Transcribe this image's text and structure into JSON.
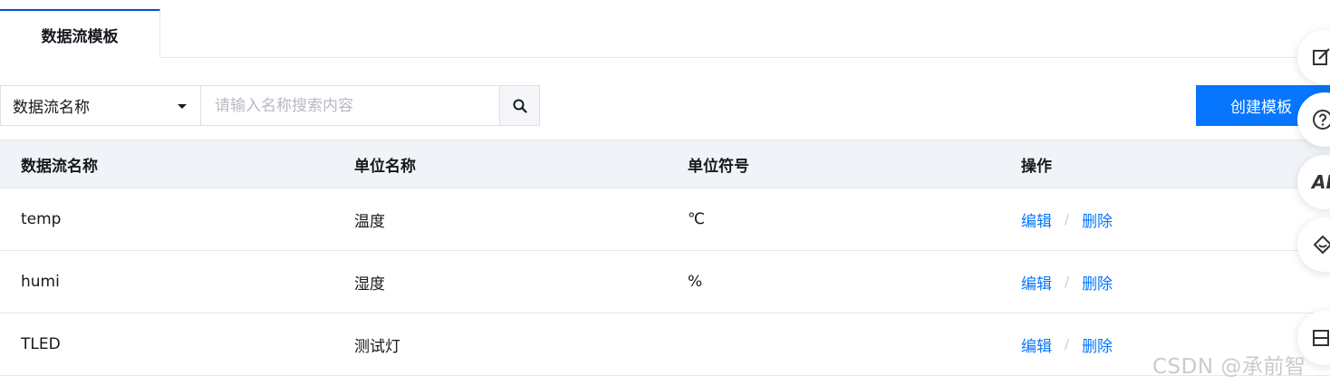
{
  "tabs": [
    {
      "label": "数据流模板",
      "active": true
    }
  ],
  "toolbar": {
    "field_select_value": "数据流名称",
    "search_placeholder": "请输入名称搜索内容",
    "create_label": "创建模板"
  },
  "table": {
    "headers": [
      "数据流名称",
      "单位名称",
      "单位符号",
      "操作"
    ],
    "rows": [
      {
        "name": "temp",
        "unit_name": "温度",
        "unit_symbol": "℃"
      },
      {
        "name": "humi",
        "unit_name": "湿度",
        "unit_symbol": "%"
      },
      {
        "name": "TLED",
        "unit_name": "测试灯",
        "unit_symbol": ""
      }
    ],
    "actions": {
      "edit": "编辑",
      "separator": "/",
      "delete": "删除"
    }
  },
  "float_tools": {
    "ai_label": "AI"
  },
  "watermark": "CSDN @承前智",
  "colors": {
    "accent": "#0676ff",
    "tab_indicator": "#0052d9",
    "header_bg": "#f0f3f7"
  },
  "icons": [
    "search-icon",
    "edit-note-icon",
    "help-icon",
    "ai-icon",
    "support-icon",
    "collapse-icon"
  ]
}
